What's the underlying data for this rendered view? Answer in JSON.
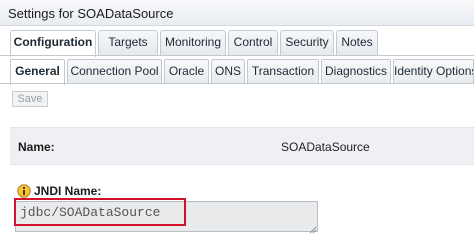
{
  "window": {
    "title": "Settings for SOADataSource"
  },
  "primary_tabs": [
    {
      "label": "Configuration",
      "active": true
    },
    {
      "label": "Targets",
      "active": false
    },
    {
      "label": "Monitoring",
      "active": false
    },
    {
      "label": "Control",
      "active": false
    },
    {
      "label": "Security",
      "active": false
    },
    {
      "label": "Notes",
      "active": false
    }
  ],
  "secondary_tabs": [
    {
      "label": "General",
      "active": true
    },
    {
      "label": "Connection Pool",
      "active": false
    },
    {
      "label": "Oracle",
      "active": false
    },
    {
      "label": "ONS",
      "active": false
    },
    {
      "label": "Transaction",
      "active": false
    },
    {
      "label": "Diagnostics",
      "active": false
    },
    {
      "label": "Identity Options",
      "active": false
    }
  ],
  "toolbar": {
    "save_label": "Save"
  },
  "form": {
    "name_label": "Name:",
    "name_value": "SOADataSource",
    "jndi_label": "JNDI Name:",
    "jndi_value": "jdbc/SOADataSource"
  },
  "icons": {
    "jndi": "info-lock-icon"
  },
  "colors": {
    "highlight": "#d0112b",
    "panel": "#eef0f3"
  }
}
